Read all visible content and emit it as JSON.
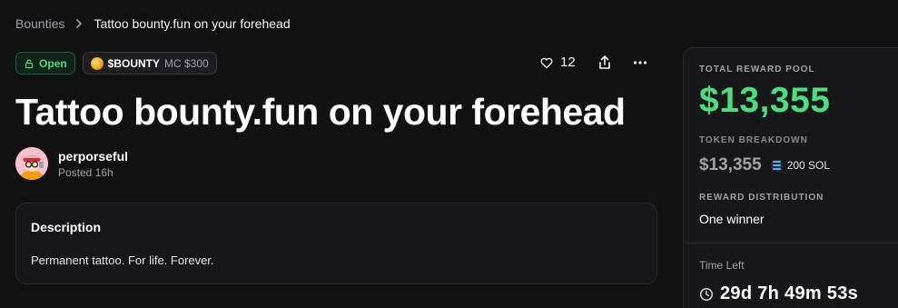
{
  "breadcrumb": {
    "root": "Bounties",
    "current": "Tattoo bounty.fun on your forehead"
  },
  "badges": {
    "status": "Open",
    "token": "$BOUNTY",
    "market_cap": "MC $300"
  },
  "actions": {
    "like_count": "12"
  },
  "bounty": {
    "title": "Tattoo bounty.fun on your forehead"
  },
  "author": {
    "name": "perporseful",
    "posted": "Posted 16h"
  },
  "description": {
    "heading": "Description",
    "body": "Permanent tattoo. For life. Forever."
  },
  "reward": {
    "pool_label": "TOTAL REWARD POOL",
    "pool_amount": "$13,355",
    "breakdown_label": "TOKEN BREAKDOWN",
    "breakdown_usd": "$13,355",
    "breakdown_sol": "200 SOL",
    "distribution_label": "REWARD DISTRIBUTION",
    "distribution_value": "One winner",
    "time_left_label": "Time Left",
    "time_left_value": "29d 7h 49m 53s"
  },
  "colors": {
    "background": "#121212",
    "accent_green": "#4ade80",
    "card": "#18181a"
  },
  "icons": {
    "breadcrumb_separator": "chevron-right-icon",
    "status": "lock-icon",
    "token": "token-coin-icon",
    "like": "heart-icon",
    "share": "share-icon",
    "more": "more-horizontal-icon",
    "sol": "solana-icon",
    "timer": "clock-icon"
  }
}
